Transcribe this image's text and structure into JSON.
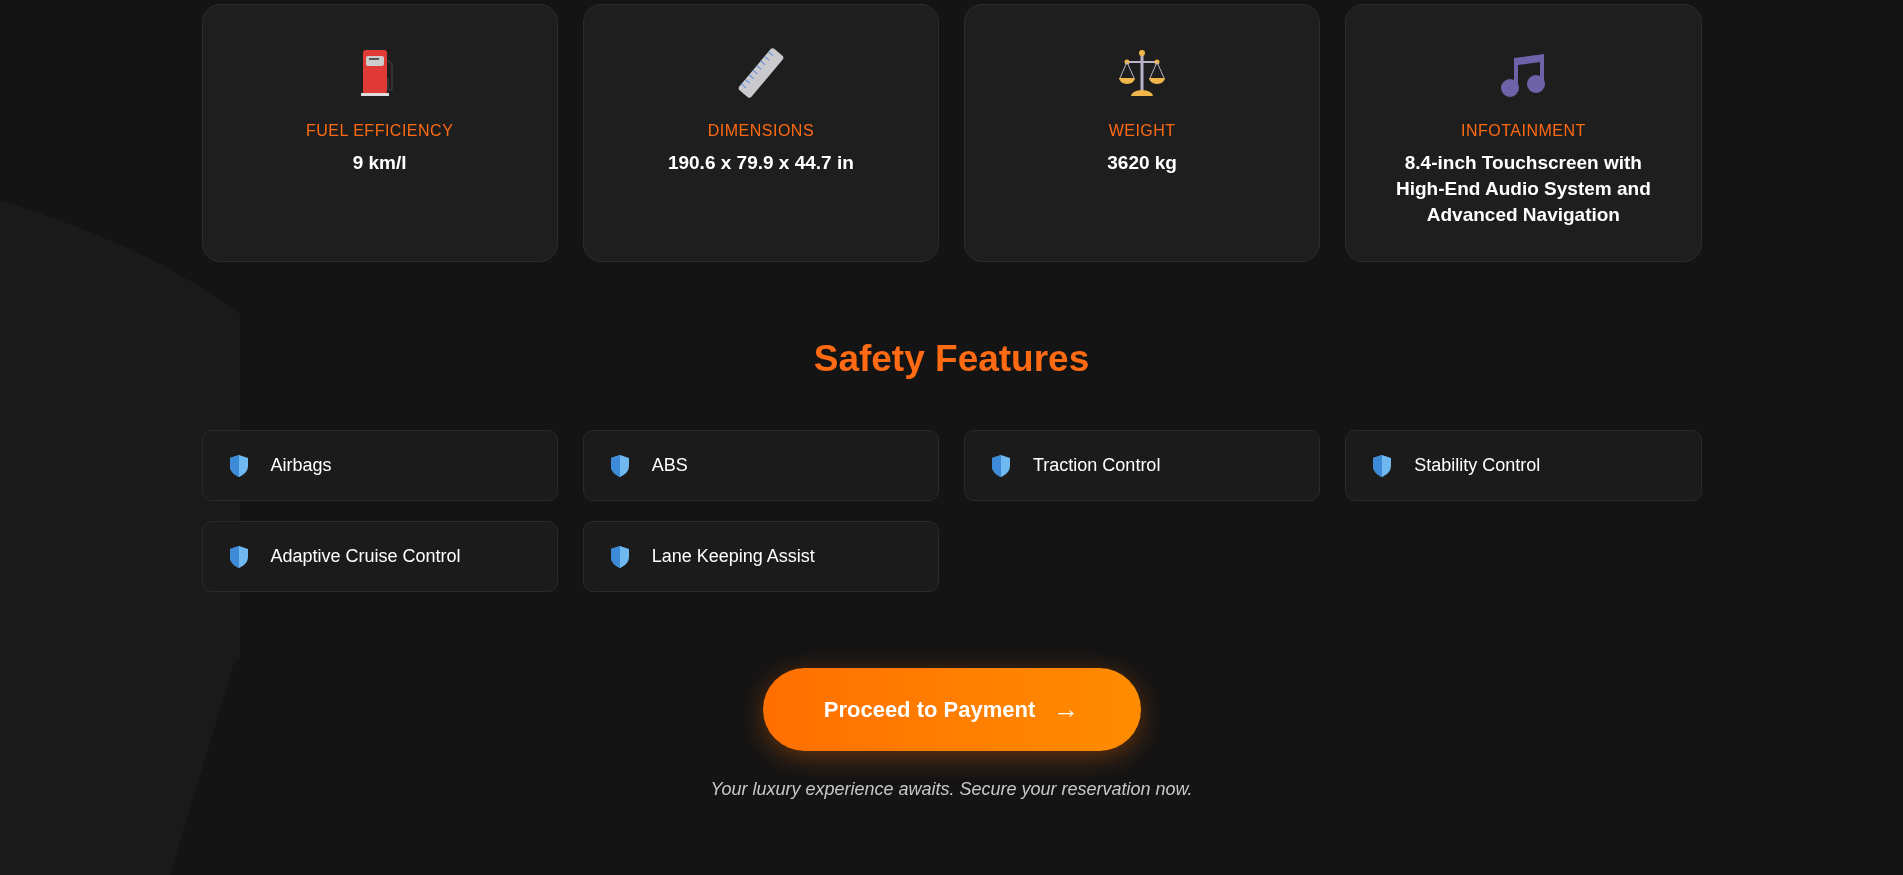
{
  "specs": [
    {
      "label": "FUEL EFFICIENCY",
      "value": "9 km/l"
    },
    {
      "label": "DIMENSIONS",
      "value": "190.6 x 79.9 x 44.7 in"
    },
    {
      "label": "WEIGHT",
      "value": "3620 kg"
    },
    {
      "label": "INFOTAINMENT",
      "value": "8.4-inch Touchscreen with High-End Audio System and Advanced Navigation"
    }
  ],
  "safety": {
    "title": "Safety Features",
    "items": [
      "Airbags",
      "ABS",
      "Traction Control",
      "Stability Control",
      "Adaptive Cruise Control",
      "Lane Keeping Assist"
    ]
  },
  "cta": {
    "label": "Proceed to Payment",
    "arrow": "→",
    "tagline": "Your luxury experience awaits. Secure your reservation now."
  }
}
